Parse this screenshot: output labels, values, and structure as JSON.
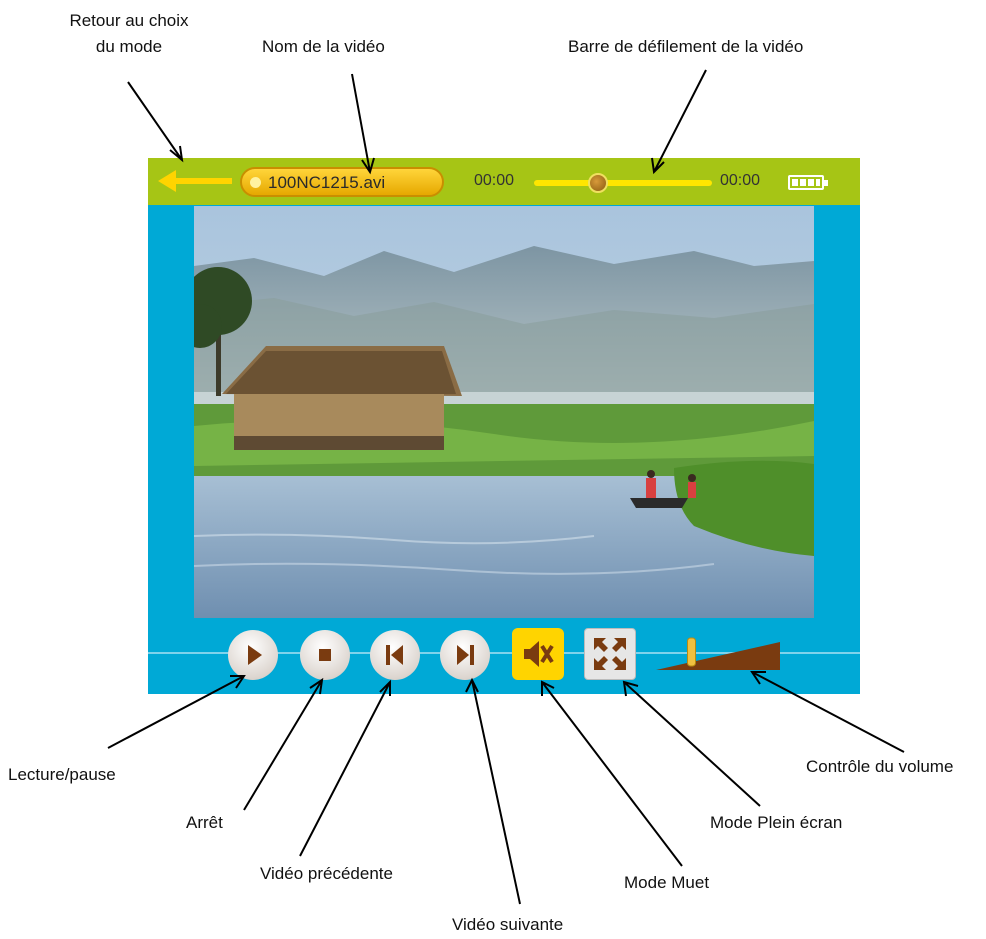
{
  "callouts": {
    "back_line1": "Retour au choix",
    "back_line2": "du mode",
    "name": "Nom de la vidéo",
    "seek": "Barre de défilement de la vidéo",
    "play": "Lecture/pause",
    "stop": "Arrêt",
    "prev": "Vidéo précédente",
    "next": "Vidéo suivante",
    "mute": "Mode Muet",
    "fullscreen": "Mode Plein écran",
    "volume": "Contrôle du volume"
  },
  "player": {
    "filename": "100NC1215.avi",
    "time_current": "00:00",
    "time_total": "00:00",
    "seek_position": 0.36,
    "volume_level": 0.25,
    "battery": "full",
    "colors": {
      "topbar": "#a6c515",
      "background": "#00a9d6",
      "accent": "#ffd400",
      "icon": "#7a3b10"
    }
  },
  "icons": [
    "back-arrow-icon",
    "battery-icon",
    "play-icon",
    "stop-icon",
    "previous-icon",
    "next-icon",
    "mute-icon",
    "fullscreen-icon",
    "volume-icon"
  ]
}
